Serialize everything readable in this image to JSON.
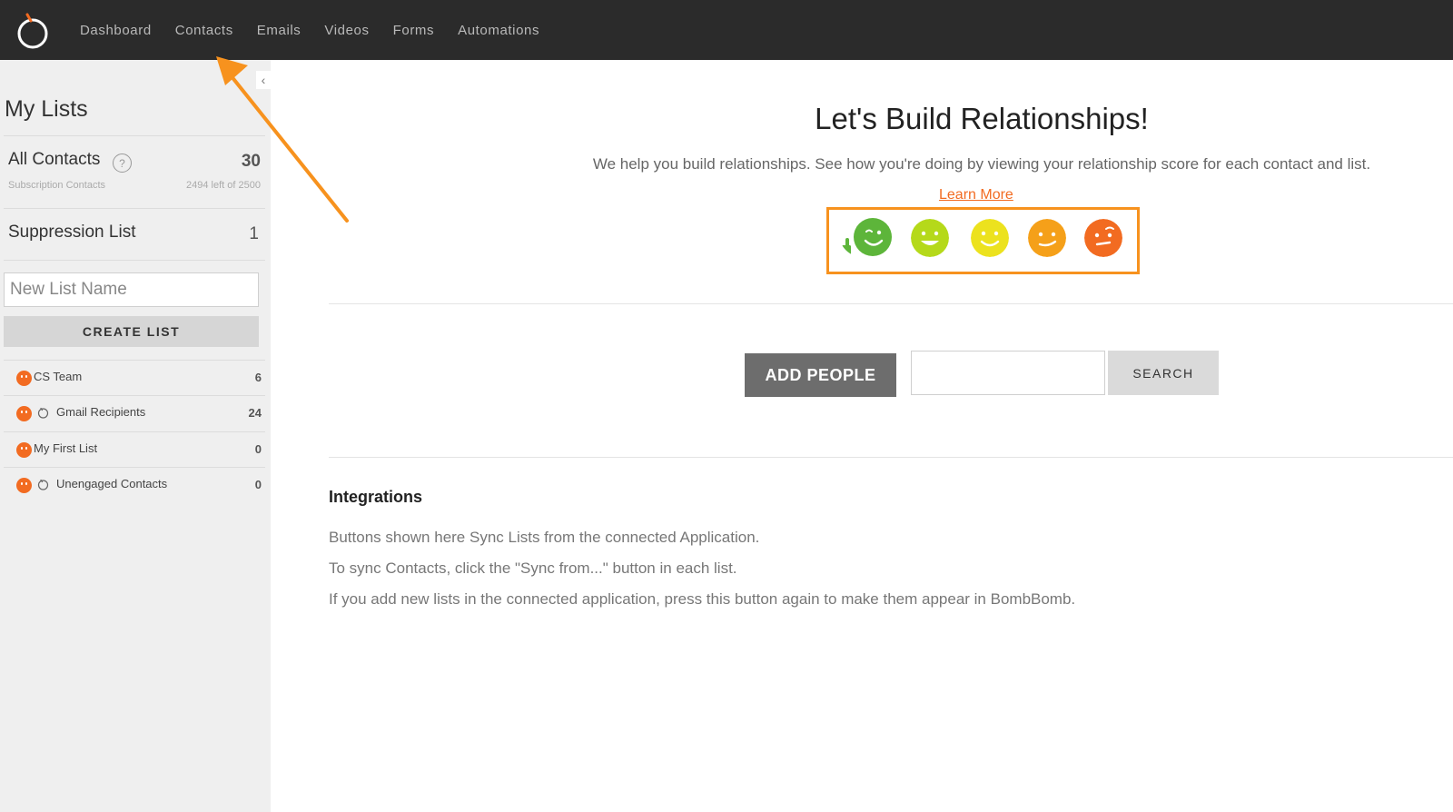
{
  "nav": {
    "items": [
      "Dashboard",
      "Contacts",
      "Emails",
      "Videos",
      "Forms",
      "Automations"
    ]
  },
  "sidebar": {
    "title": "My Lists",
    "all_contacts": {
      "label": "All Contacts",
      "help": "?",
      "count": "30",
      "sub_label": "Subscription Contacts",
      "sub_count": "2494 left of 2500"
    },
    "suppression": {
      "label": "Suppression List",
      "count": "1"
    },
    "new_list_placeholder": "New List Name",
    "create_label": "CREATE LIST",
    "lists": [
      {
        "name": "CS Team",
        "count": "6",
        "synced": false
      },
      {
        "name": "Gmail Recipients",
        "count": "24",
        "synced": true
      },
      {
        "name": "My First List",
        "count": "0",
        "synced": false
      },
      {
        "name": "Unengaged Contacts",
        "count": "0",
        "synced": true
      }
    ]
  },
  "main": {
    "headline": "Let's Build Relationships!",
    "subhead": "We help you build relationships. See how you're doing by viewing your relationship score for each contact and list.",
    "learn_more": "Learn More",
    "score_faces": [
      {
        "icon": "thumbs-up-wink-face-icon",
        "color": "#5db53a"
      },
      {
        "icon": "grin-face-icon",
        "color": "#b5d91a"
      },
      {
        "icon": "smile-face-icon",
        "color": "#ece21e"
      },
      {
        "icon": "half-smile-face-icon",
        "color": "#f5a019"
      },
      {
        "icon": "skeptical-face-icon",
        "color": "#f26b21"
      }
    ],
    "add_people": "ADD PEOPLE",
    "search_label": "SEARCH",
    "integrations_title": "Integrations",
    "integrations_lines": [
      "Buttons shown here Sync Lists from the connected Application.",
      "To sync Contacts, click the \"Sync from...\" button in each list.",
      "If you add new lists in the connected application, press this button again to make them appear in BombBomb."
    ]
  },
  "colors": {
    "topbar": "#2b2b2b",
    "accent": "#f26b21",
    "highlight": "#f7921e"
  }
}
